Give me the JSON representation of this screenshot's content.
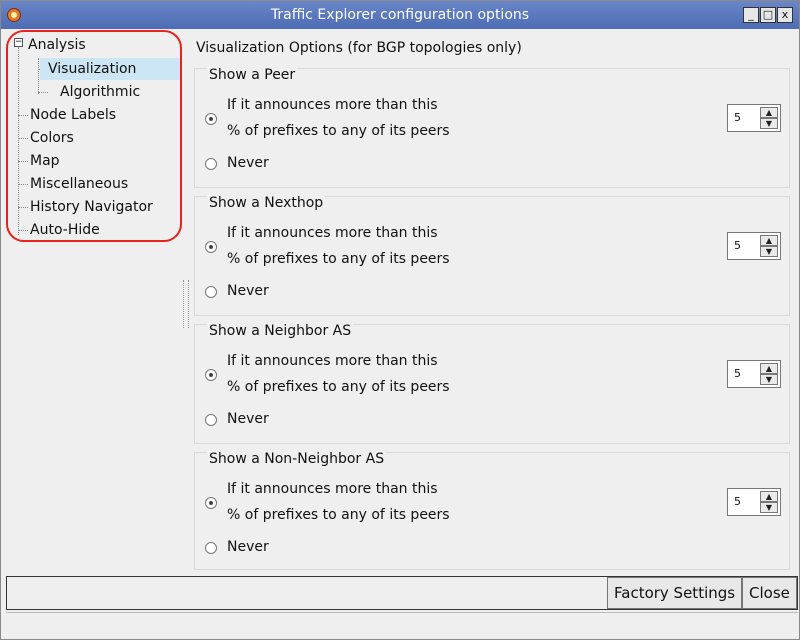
{
  "window": {
    "title": "Traffic Explorer configuration options",
    "controls": [
      "_",
      "□",
      "x"
    ]
  },
  "tree": {
    "items": [
      {
        "label": "Analysis",
        "level": 0
      },
      {
        "label": "Visualization",
        "level": 1,
        "selected": true
      },
      {
        "label": "Algorithmic",
        "level": 1
      },
      {
        "label": "Node Labels",
        "level": 0
      },
      {
        "label": "Colors",
        "level": 0
      },
      {
        "label": "Map",
        "level": 0
      },
      {
        "label": "Miscellaneous",
        "level": 0
      },
      {
        "label": "History Navigator",
        "level": 0
      },
      {
        "label": "Auto-Hide",
        "level": 0
      }
    ],
    "expander_symbol": "−"
  },
  "main": {
    "title": "Visualization Options (for BGP topologies only)",
    "sections": [
      {
        "title": "Show a Peer",
        "option_line1": "If it announces more than this",
        "option_line2": "% of prefixes to any of its peers",
        "never_label": "Never",
        "value": "5"
      },
      {
        "title": "Show a Nexthop",
        "option_line1": "If it announces more than this",
        "option_line2": "% of prefixes to any of its peers",
        "never_label": "Never",
        "value": "5"
      },
      {
        "title": "Show a Neighbor AS",
        "option_line1": "If it announces more than this",
        "option_line2": "% of prefixes to any of its peers",
        "never_label": "Never",
        "value": "5"
      },
      {
        "title": "Show a Non-Neighbor AS",
        "option_line1": "If it announces more than this",
        "option_line2": "% of prefixes to any of its peers",
        "never_label": "Never",
        "value": "5"
      }
    ]
  },
  "buttons": {
    "factory_settings": "Factory Settings",
    "close": "Close"
  },
  "colors": {
    "titlebar": "#5a78be",
    "selection": "#cde6f5",
    "annotation_ring": "#e8231b"
  }
}
